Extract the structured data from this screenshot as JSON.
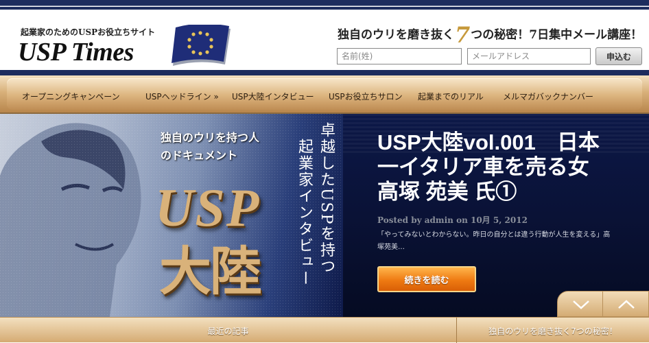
{
  "header": {
    "tagline": "起業家のためのUSPお役立ちサイト",
    "logo": "USP Times",
    "promo_before": "独自のウリを磨き抜く",
    "promo_number": "7",
    "promo_after": "つの秘密！7日集中メール講座！",
    "name_placeholder": "名前(姓)",
    "email_placeholder": "メールアドレス",
    "submit_label": "申込む"
  },
  "nav": {
    "items": [
      {
        "label": "オープニングキャンペーン"
      },
      {
        "label": "USPヘッドライン »"
      },
      {
        "label": "USP大陸インタビュー"
      },
      {
        "label": "USPお役立ちサロン"
      },
      {
        "label": "起業までのリアル"
      },
      {
        "label": "メルマガバックナンバー"
      }
    ]
  },
  "hero": {
    "doc_label_1": "独自のウリを持つ人",
    "doc_label_2": "のドキュメント",
    "big_usp": "USP",
    "big_tairiku": "大陸",
    "vertical_1": "卓越したUSPを持つ",
    "vertical_2": "起業家インタビュー",
    "post_title": "USP大陸vol.001　日本一イタリア車を売る女　高塚 苑美 氏①",
    "post_meta": "Posted by admin on 10月 5, 2012",
    "post_excerpt": "「やってみないとわからない。昨日の自分とは違う行動が人生を変える」高塚苑美…",
    "read_more": "続きを読む"
  },
  "bottom": {
    "left_label": "最近の記事",
    "right_label": "独自のウリを磨き抜く7つの秘密！"
  },
  "colors": {
    "navy": "#1d2c5e",
    "gold": "#d9b27a",
    "orange_button": "#ee7a12"
  }
}
